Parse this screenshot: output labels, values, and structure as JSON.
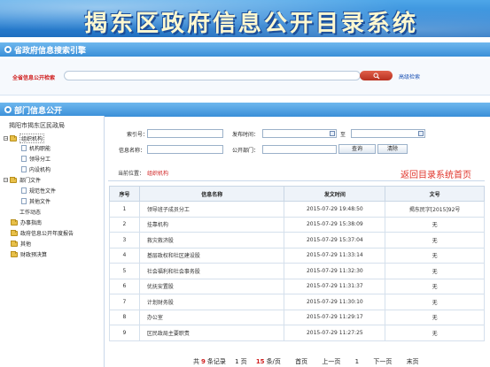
{
  "banner": {
    "title": "揭东区政府信息公开目录系统"
  },
  "province_search": {
    "header": "省政府信息搜索引擎",
    "label": "全省信息公开检索",
    "query": "",
    "advanced": "高级检索"
  },
  "dept_section": {
    "header": "部门信息公开"
  },
  "tree": {
    "root": "揭阳市揭东区民政局",
    "nodes": [
      {
        "label": "组织机构"
      },
      {
        "label": "机构职能"
      },
      {
        "label": "领导分工"
      },
      {
        "label": "内设机构"
      },
      {
        "label": "部门文件"
      },
      {
        "label": "规范性文件"
      },
      {
        "label": "其他文件"
      },
      {
        "label": "工作动态"
      },
      {
        "label": "办事指南"
      },
      {
        "label": "政府信息公开年度报告"
      },
      {
        "label": "其他"
      },
      {
        "label": "财政预决算"
      }
    ]
  },
  "filter": {
    "index_label": "索引号：",
    "date_label": "发布时间：",
    "date_to": "至",
    "name_label": "信息名称：",
    "dept_label": "公开部门：",
    "query_btn": "查询",
    "clear_btn": "清除"
  },
  "location": {
    "label": "当前位置：",
    "current": "组织机构"
  },
  "back_link": "返回目录系统首页",
  "table": {
    "headers": [
      "序号",
      "信息名称",
      "发文时间",
      "文号"
    ],
    "rows": [
      [
        "1",
        "领导班子成员分工",
        "2015-07-29 19:48:50",
        "揭东民字[2015]92号"
      ],
      [
        "2",
        "挂靠机构",
        "2015-07-29 15:38:09",
        "无"
      ],
      [
        "3",
        "救灾救济股",
        "2015-07-29 15:37:04",
        "无"
      ],
      [
        "4",
        "基层政权和社区建设股",
        "2015-07-29 11:33:14",
        "无"
      ],
      [
        "5",
        "社会福利和社会事务股",
        "2015-07-29 11:32:30",
        "无"
      ],
      [
        "6",
        "优抚安置股",
        "2015-07-29 11:31:37",
        "无"
      ],
      [
        "7",
        "计划财务股",
        "2015-07-29 11:30:10",
        "无"
      ],
      [
        "8",
        "办公室",
        "2015-07-29 11:29:17",
        "无"
      ],
      [
        "9",
        "区民政局主要职责",
        "2015-07-29 11:27:25",
        "无"
      ]
    ]
  },
  "pager": {
    "total_prefix": "共",
    "total": "9",
    "total_suffix": "条记录",
    "pages": "1",
    "pages_suffix": "页",
    "per_page": "15",
    "per_page_suffix": "条/页",
    "first": "首页",
    "prev": "上一页",
    "current": "1",
    "next": "下一页",
    "last": "末页"
  },
  "colors": {
    "banner": "#2f86d6",
    "accent_red": "#d02020",
    "link_blue": "#1f55b5"
  },
  "icons": {
    "search": "search-icon",
    "folder": "folder-icon",
    "document": "document-icon"
  }
}
